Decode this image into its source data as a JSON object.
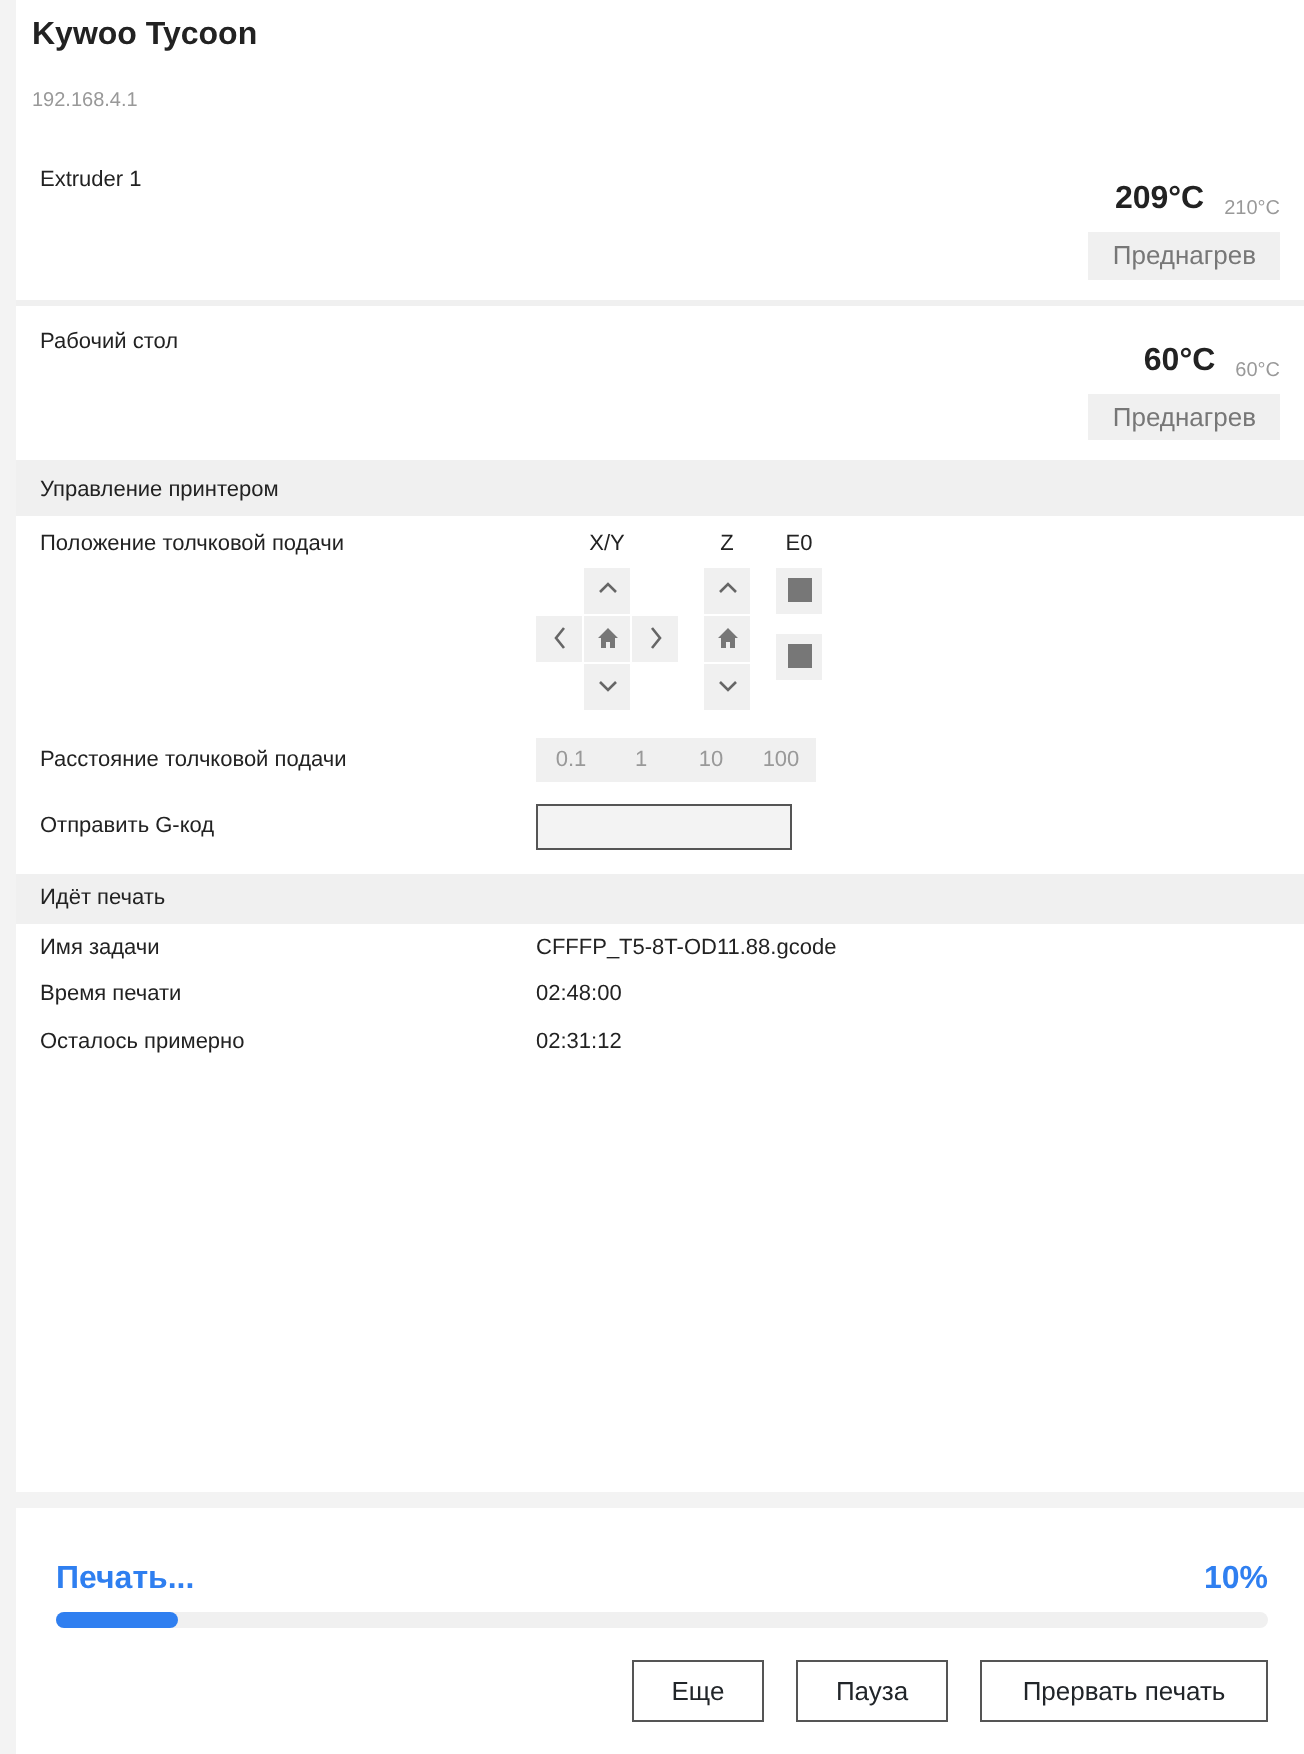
{
  "app": {
    "title": "Kywoo Tycoon",
    "address": "192.168.4.1"
  },
  "heaters": [
    {
      "name": "Extruder 1",
      "current": "209°C",
      "target": "210°C",
      "button": "Преднагрев"
    },
    {
      "name": "Рабочий стол",
      "current": "60°C",
      "target": "60°C",
      "button": "Преднагрев"
    }
  ],
  "control": {
    "title": "Управление принтером",
    "jog_label": "Положение толчковой подачи",
    "axes": [
      {
        "label": "X/Y",
        "kind": "xy"
      },
      {
        "label": "Z",
        "kind": "z"
      },
      {
        "label": "E0",
        "kind": "extruder"
      }
    ],
    "distance_label": "Расстояние толчковой подачи",
    "distances": [
      "0.1",
      "1",
      "10",
      "100"
    ],
    "gcode_label": "Отправить G-код"
  },
  "job": {
    "title": "Идёт печать",
    "rows": [
      {
        "label": "Имя задачи",
        "value": "CFFFP_T5-8T-OD11.88.gcode"
      },
      {
        "label": "Время печати",
        "value": "02:48:00"
      },
      {
        "label": "Осталось примерно",
        "value": "02:31:12"
      }
    ]
  },
  "progress": {
    "status": "Печать...",
    "percent": "10%",
    "level": 0.1
  },
  "buttons": [
    "Еще",
    "Пауза",
    "Прервать печать"
  ]
}
